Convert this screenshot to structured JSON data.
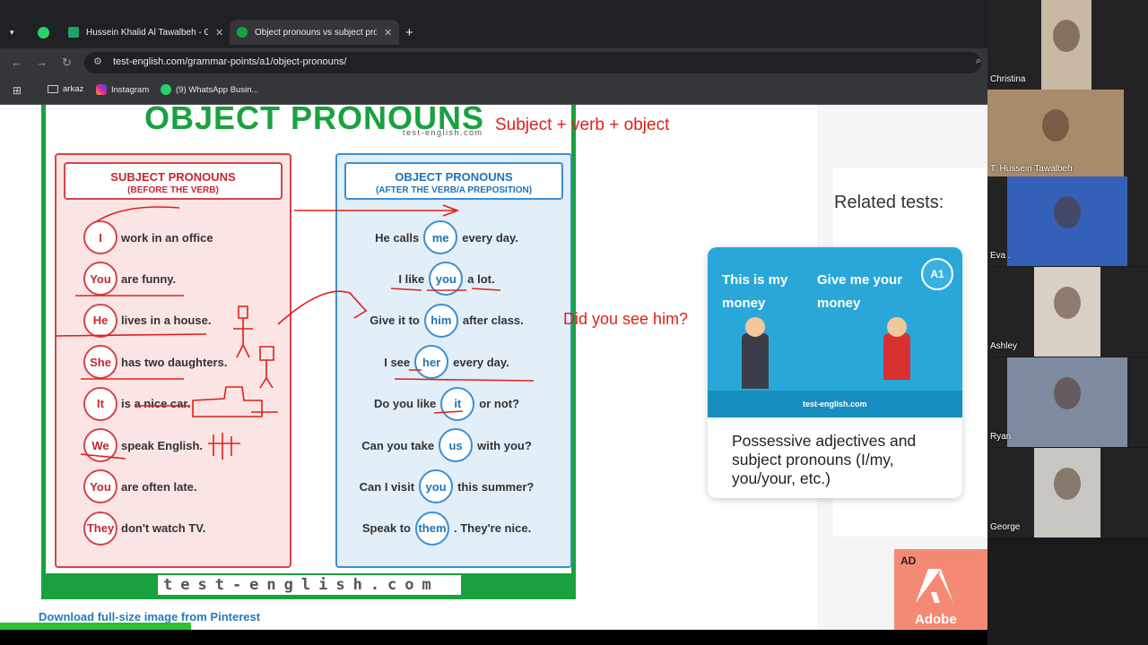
{
  "browser": {
    "tabs": [
      {
        "title": "Hussein Khalid Al Tawalbeh - Go",
        "favicon_color": "#1ea362",
        "active": false
      },
      {
        "title": "Object pronouns vs subject pro",
        "favicon_color": "#19a13f",
        "active": true
      }
    ],
    "url": "test-english.com/grammar-points/a1/object-pronouns/",
    "bookmarks": [
      "arkaz",
      "Instagram",
      "(9) WhatsApp Busin..."
    ]
  },
  "poster": {
    "title": "OBJECT PRONOUNS",
    "site": "test-english.com",
    "subject_header": "SUBJECT PRONOUNS",
    "subject_sub": "(BEFORE THE VERB)",
    "object_header": "OBJECT PRONOUNS",
    "object_sub": "(AFTER THE VERB/A PREPOSITION)",
    "subject_rows": [
      {
        "pron": "I",
        "rest": "work in an office"
      },
      {
        "pron": "You",
        "rest": "are funny."
      },
      {
        "pron": "He",
        "rest": "lives in a house."
      },
      {
        "pron": "She",
        "rest": "has two daughters."
      },
      {
        "pron": "It",
        "rest": "is a nice car."
      },
      {
        "pron": "We",
        "rest": "speak English."
      },
      {
        "pron": "You",
        "rest": "are often late."
      },
      {
        "pron": "They",
        "rest": "don't watch TV."
      }
    ],
    "object_rows": [
      {
        "pre": "He calls",
        "pron": "me",
        "post": "every day."
      },
      {
        "pre": "I like",
        "pron": "you",
        "post": "a lot."
      },
      {
        "pre": "Give it to",
        "pron": "him",
        "post": "after class."
      },
      {
        "pre": "I see",
        "pron": "her",
        "post": "every day."
      },
      {
        "pre": "Do you like",
        "pron": "it",
        "post": "or not?"
      },
      {
        "pre": "Can you take",
        "pron": "us",
        "post": "with you?"
      },
      {
        "pre": "Can I visit",
        "pron": "you",
        "post": "this summer?"
      },
      {
        "pre": "Speak to",
        "pron": "them",
        "post": ". They're nice."
      }
    ],
    "footer": "test-english.com"
  },
  "download_link": "Download full-size image from Pinterest",
  "annotations": {
    "formula": "Subject + verb + object",
    "question": "Did you see him?"
  },
  "related": {
    "title": "Related tests:",
    "card_text": "Possessive adjectives and subject pronouns (I/my, you/your, etc.)",
    "card_img_left": "This is my money",
    "card_img_right": "Give me your money",
    "card_level": "A1",
    "card_site": "test-english.com"
  },
  "ad": {
    "tag": "AD",
    "brand": "Adobe"
  },
  "participants": [
    "Christina",
    "T. Hussein Tawalbeh",
    "Eva .",
    "Ashley",
    "Ryan",
    "George"
  ]
}
